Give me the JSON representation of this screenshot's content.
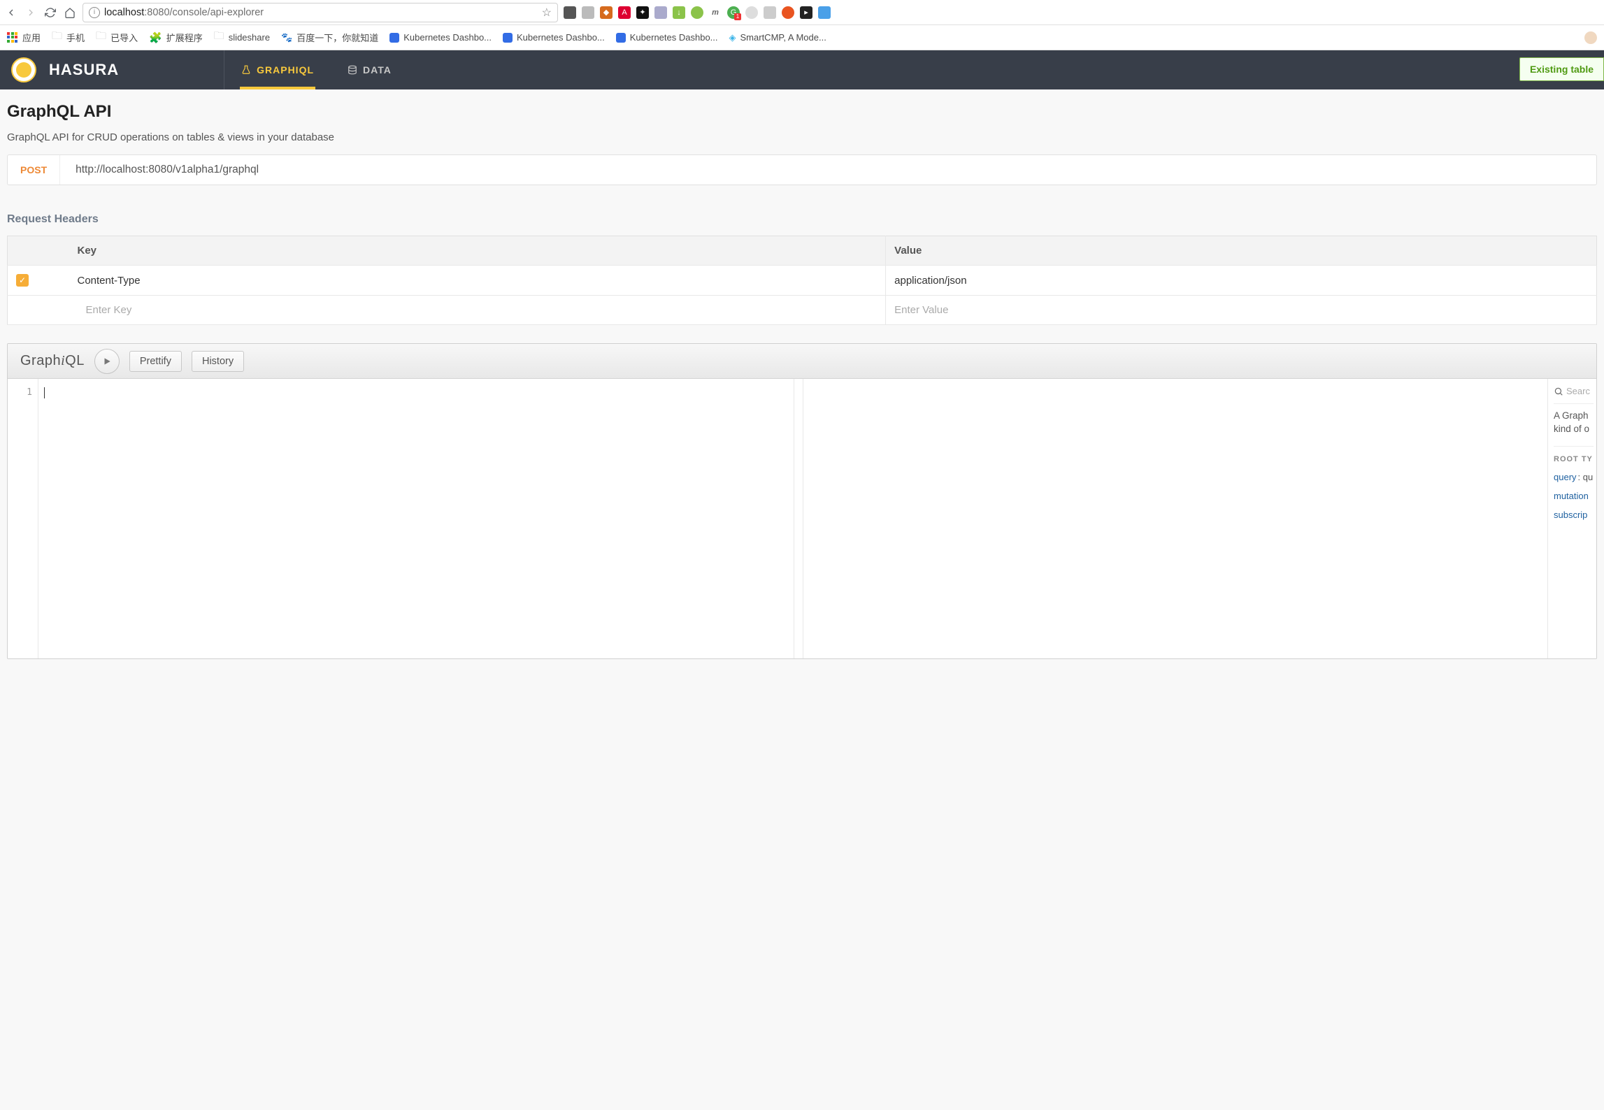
{
  "browser": {
    "url_host": "localhost",
    "url_port": ":8080",
    "url_path": "/console/api-explorer",
    "bookmarks": {
      "apps": "应用",
      "phone": "手机",
      "imported": "已导入",
      "extensions": "扩展程序",
      "slideshare": "slideshare",
      "baidu": "百度一下，你就知道",
      "kube1": "Kubernetes Dashbo...",
      "kube2": "Kubernetes Dashbo...",
      "kube3": "Kubernetes Dashbo...",
      "smartcmp": "SmartCMP, A Mode..."
    }
  },
  "header": {
    "brand": "HASURA",
    "tab_graphiql": "GRAPHIQL",
    "tab_data": "DATA",
    "notification": "Existing table"
  },
  "page": {
    "title": "GraphQL API",
    "description": "GraphQL API for CRUD operations on tables & views in your database",
    "method": "POST",
    "endpoint": "http://localhost:8080/v1alpha1/graphql"
  },
  "headers_section": {
    "title": "Request Headers",
    "col_key": "Key",
    "col_value": "Value",
    "row_key": "Content-Type",
    "row_value": "application/json",
    "placeholder_key": "Enter Key",
    "placeholder_value": "Enter Value"
  },
  "graphiql": {
    "logo_a": "Graph",
    "logo_b": "i",
    "logo_c": "QL",
    "prettify": "Prettify",
    "history": "History",
    "line1": "1",
    "docs": {
      "search_placeholder": "Searc",
      "blurb1": "A Graph",
      "blurb2": "kind of o",
      "root_title": "ROOT TY",
      "query_kw": "query",
      "query_type": ": qu",
      "mutation": "mutation",
      "subscription": "subscrip"
    }
  }
}
